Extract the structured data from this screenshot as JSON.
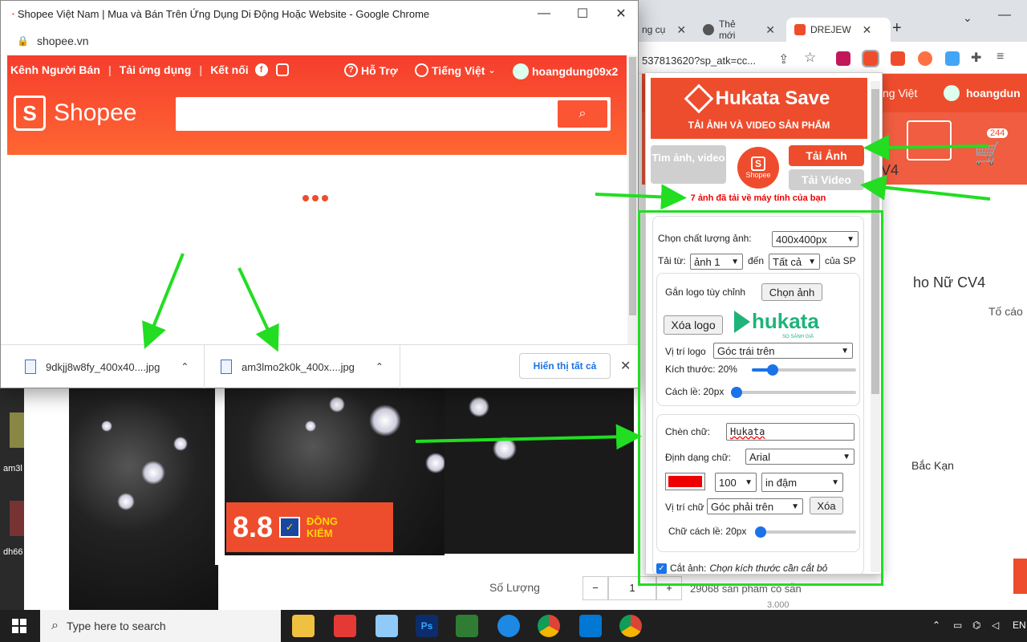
{
  "front_window": {
    "title": "Shopee Việt Nam | Mua và Bán Trên Ứng Dụng Di Động Hoặc Website - Google Chrome",
    "address": "shopee.vn",
    "minimize": "—",
    "maximize": "☐",
    "close": "✕"
  },
  "shopee_header": {
    "nav_left": [
      "Kênh Người Bán",
      "Tải ứng dụng",
      "Kết nối"
    ],
    "help": "Hỗ Trợ",
    "language": "Tiếng Việt",
    "username": "hoangdung09x2",
    "logo_text": "Shopee"
  },
  "downloads": {
    "items": [
      "9dkjj8w8fy_400x40....jpg",
      "am3lmo2k0k_400x....jpg"
    ],
    "show_all": "Hiển thị tất cả"
  },
  "bg_window": {
    "tabs": [
      "ng cụ",
      "Thẻ mới",
      "DREJEW"
    ],
    "url_fragment": "537813620?sp_atk=cc...",
    "language": "ng Việt",
    "username": "hoangdun",
    "cart_count": "244",
    "product_title": "ho Nữ CV4",
    "title_short": "V4",
    "report": "Tố cáo",
    "location": "Bắc Kạn",
    "quantity_label": "Số Lượng",
    "quantity_value": "1",
    "stock": "29068 sản phẩm có sẵn",
    "stock_below": "3.000"
  },
  "product_banner": {
    "sale": "8.8",
    "badge": "ĐỒNG KIỂM"
  },
  "hukata": {
    "brand": "Hukata Save",
    "subtitle": "TẢI ẢNH VÀ VIDEO SẢN PHẨM",
    "find_btn": "Tìm ảnh, video",
    "shopee_label": "Shopee",
    "download_images": "Tải Ảnh",
    "download_video": "Tải Video",
    "message": "7 ảnh đã tải về máy tính của bạn",
    "quality_label": "Chọn chất lượng ảnh:",
    "quality_value": "400x400px",
    "from_label": "Tải từ:",
    "from_value": "ảnh 1",
    "to_label": "đến",
    "to_value": "Tất cả",
    "of_sp": "của SP",
    "logo_label": "Gắn logo tùy chỉnh",
    "choose_image": "Chọn ảnh",
    "remove_logo": "Xóa logo",
    "logo_brand": "hukata",
    "logo_tag": "SO SÁNH GIÁ",
    "logo_pos_label": "Vị trí logo",
    "logo_pos_value": "Góc trái trên",
    "size_label": "Kích thước: 20%",
    "size_percent": 20,
    "margin_label": "Cách lề: 20px",
    "margin_percent": 3,
    "text_label": "Chèn chữ:",
    "text_value": "Hukata",
    "font_label": "Định dạng chữ:",
    "font_value": "Arial",
    "text_color": "#ee0000",
    "font_size_value": "100",
    "weight_value": "in đậm",
    "text_pos_label": "Vị trí chữ",
    "text_pos_value": "Góc phải trên",
    "delete_btn": "Xóa",
    "text_margin_label": "Chữ cách lề: 20px",
    "text_margin_percent": 3,
    "crop_label": "Cắt ảnh:",
    "crop_hint": "Chọn kích thước cần cắt bỏ"
  },
  "taskbar": {
    "search_placeholder": "Type here to search",
    "tray_lang": "EN"
  },
  "desktop": {
    "icon_labels": [
      "am3l",
      "dh66"
    ]
  },
  "colors": {
    "shopee_orange": "#ee4d2d",
    "annotation_green": "#22dd22"
  }
}
